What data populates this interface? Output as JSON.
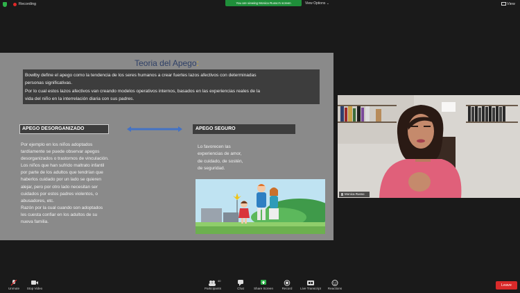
{
  "topbar": {
    "recording_label": "Recording",
    "viewing_banner": "You are viewing Monica Russo's screen",
    "view_options": "View Options",
    "view_button": "View"
  },
  "slide": {
    "title": "Teoria del Apego",
    "title_colon": ":",
    "intro_lines": [
      "Bowlby define el apego como  la tendencia de los seres humanos a crear fuertes lazos afectivos con determinadas",
      "personas significativas.",
      "Por lo cual estos lazos afectivos van creando modelos operativos internos, basados en las experiencias reales de la",
      "vida del niño en la interrelación diaria con sus padres."
    ],
    "left_header": "APEGO DESORGANIZADO",
    "right_header": "APEGO SEGURO",
    "left_body": "Por ejemplo en los niños adoptados\ntardíamente se puede observar apegos\ndesorganizados o trastornos de vinculación.\nLos niños que han sufrido maltrato infantil\npor parte de  los adultos que tendrían que\nhaberlos  cuidado por un lado se quieren\nalejar,  pero por otro lado necesitan ser\ncuidados por estos padres  violentos, o\nabusadores, etc.\nRazón  por la cual cuando son adoptados\nles cuesta confiar en los adultos de su\nnueva familia.",
    "right_body": "Lo favorecen las\nexperiencias de amor,\nde cuidado, de sostén,\nde seguridad."
  },
  "webcam": {
    "participant_name": "Monica Russo"
  },
  "toolbar": {
    "unmute": "Unmute",
    "stop_video": "Stop Video",
    "participants": "Participants",
    "participants_count": "40",
    "chat": "Chat",
    "share_screen": "Share Screen",
    "record": "Record",
    "live_transcript": "Live Transcript",
    "reactions": "Reactions",
    "leave": "Leave"
  },
  "colors": {
    "slide_bg": "#8a8a8a",
    "title_color": "#2e3f66",
    "arrow_color": "#4472c4",
    "leave_red": "#d92a2a",
    "share_green": "#1f8f3a"
  }
}
